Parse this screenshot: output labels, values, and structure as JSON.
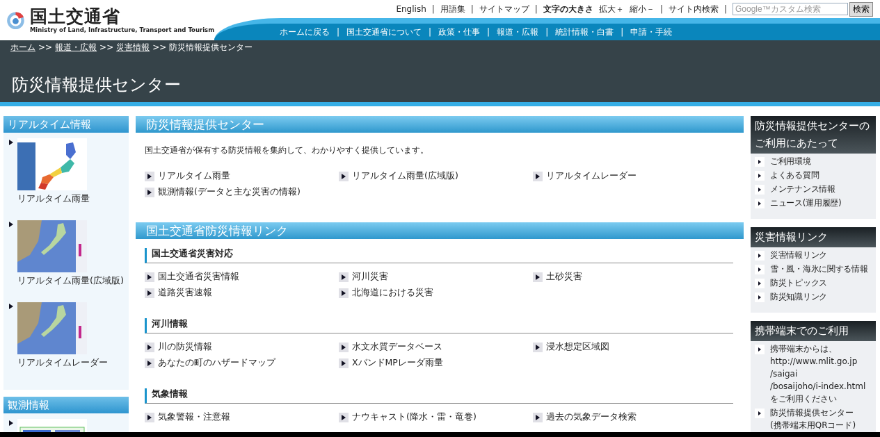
{
  "header": {
    "logo_title": "国土交通省",
    "logo_subtitle": "Ministry of Land, Infrastructure, Transport and Tourism",
    "separator": "|",
    "util_links": [
      "English",
      "用語集",
      "サイトマップ"
    ],
    "font_size_label": "文字の大きさ",
    "font_size_controls": [
      "拡大＋",
      "縮小－"
    ],
    "site_search_link": "サイト内検索",
    "search": {
      "placeholder": "Google™カスタム検索",
      "button": "検索"
    },
    "nav": [
      "ホームに戻る",
      "国土交通省について",
      "政策・仕事",
      "報道・広報",
      "統計情報・白書",
      "申請・手続"
    ]
  },
  "breadcrumb": {
    "separator": ">>",
    "items": [
      {
        "label": "ホーム",
        "link": true
      },
      {
        "label": "報道・広報",
        "link": true
      },
      {
        "label": "災害情報",
        "link": true
      },
      {
        "label": "防災情報提供センター",
        "link": false
      }
    ]
  },
  "page_title": "防災情報提供センター",
  "left_sidebar": [
    {
      "title": "リアルタイム情報",
      "items": [
        {
          "label": "リアルタイム雨量",
          "kind": "picture"
        },
        {
          "label": "リアルタイム雨量(広域版)",
          "kind": "picture"
        },
        {
          "label": "リアルタイムレーダー",
          "kind": "picture"
        }
      ]
    },
    {
      "title": "観測情報"
    }
  ],
  "main": {
    "title": "防災情報提供センター",
    "intro": "国土交通省が保有する防災情報を集約して、わかりやすく提供しています。",
    "links": [
      "リアルタイム雨量",
      "リアルタイム雨量(広域版)",
      "リアルタイムレーダー",
      "観測情報(データと主な災害の情報)"
    ],
    "links_title": "国土交通省防災情報リンク",
    "groups": [
      {
        "heading": "国土交通省災害対応",
        "links": [
          "国土交通省災害情報",
          "河川災害",
          "土砂災害",
          "道路災害速報",
          "北海道における災害"
        ]
      },
      {
        "heading": "河川情報",
        "links": [
          "川の防災情報",
          "水文水質データベース",
          "浸水想定区域図",
          "あなたの町のハザードマップ",
          "XバンドMPレーダ雨量"
        ]
      },
      {
        "heading": "気象情報",
        "links": [
          "気象警報・注意報",
          "ナウキャスト(降水・雷・竜巻)",
          "過去の気象データ検索"
        ]
      }
    ]
  },
  "right_sidebar": [
    {
      "title": "防災情報提供センターのご利用にあたって",
      "items": [
        {
          "kind": "link",
          "lines": [
            "ご利用環境"
          ]
        },
        {
          "kind": "link",
          "lines": [
            "よくある質問"
          ]
        },
        {
          "kind": "link",
          "lines": [
            "メンテナンス情報"
          ]
        },
        {
          "kind": "link",
          "lines": [
            "ニュース(運用履歴)"
          ]
        }
      ]
    },
    {
      "title": "災害情報リンク",
      "items": [
        {
          "kind": "link",
          "lines": [
            "災害情報リンク"
          ]
        },
        {
          "kind": "link",
          "lines": [
            "雪・風・海氷に関する情報"
          ]
        },
        {
          "kind": "link",
          "lines": [
            "防災トピックス"
          ]
        },
        {
          "kind": "link",
          "lines": [
            "防災知識リンク"
          ]
        }
      ]
    },
    {
      "title": "携帯端末でのご利用",
      "items": [
        {
          "kind": "text",
          "lines": [
            "携帯端末からは、",
            "http://www.mlit.go.jp",
            "/saigai",
            "/bosaijoho/i-index.html",
            "をご利用ください"
          ]
        },
        {
          "kind": "text",
          "lines": [
            "防災情報提供センター",
            "(携帯端末用QRコード)"
          ]
        }
      ]
    }
  ]
}
